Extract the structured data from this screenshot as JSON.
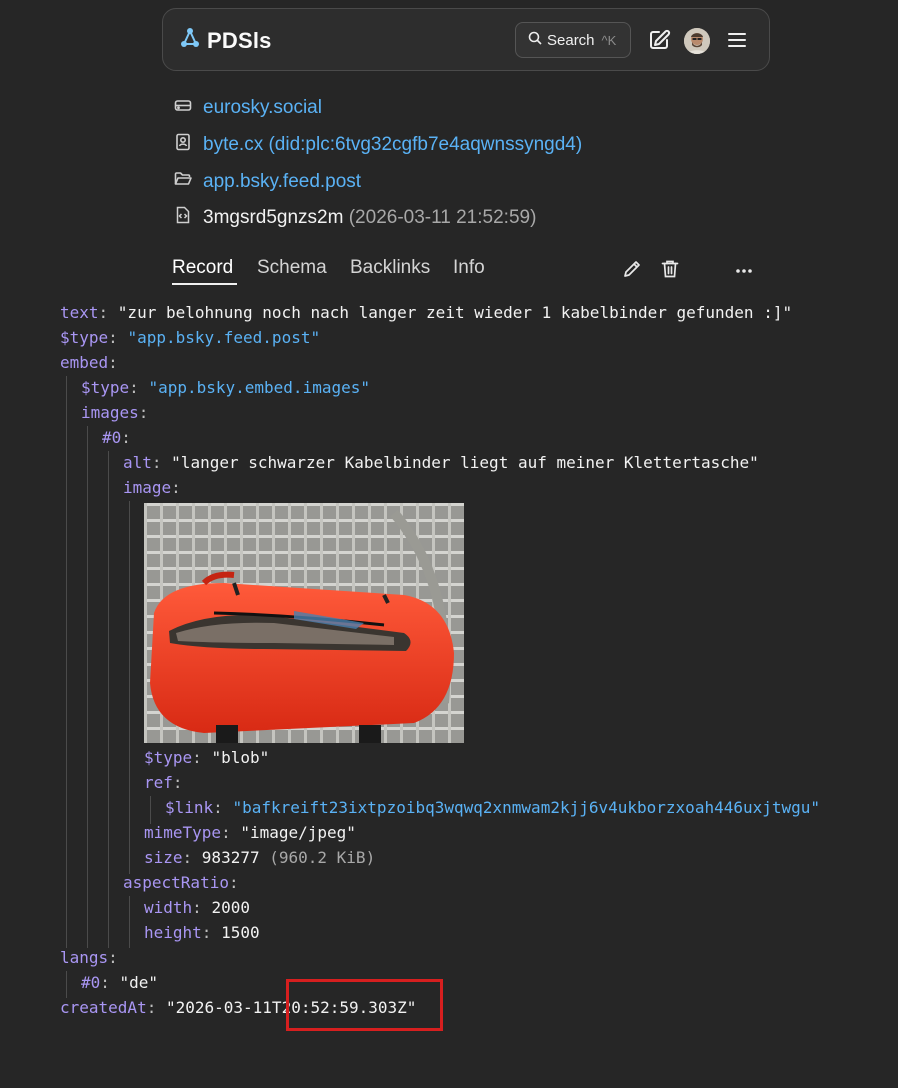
{
  "app": {
    "name": "PDSls"
  },
  "search": {
    "label": "Search",
    "shortcut": "^K"
  },
  "breadcrumbs": [
    {
      "icon": "server-icon",
      "text": "eurosky.social"
    },
    {
      "icon": "contact-card-icon",
      "text": "byte.cx (did:plc:6tvg32cgfb7e4aqwnssyngd4)"
    },
    {
      "icon": "folder-icon",
      "text": "app.bsky.feed.post"
    },
    {
      "icon": "code-file-icon",
      "text": "3mgsrd5gnzs2m",
      "date": "(2026-03-11 21:52:59)"
    }
  ],
  "tabs": [
    "Record",
    "Schema",
    "Backlinks",
    "Info"
  ],
  "active_tab": "Record",
  "record": {
    "text_key": "text",
    "text_value": "\"zur belohnung noch nach langer zeit wieder 1 kabelbinder gefunden :]\"",
    "type_key": "$type",
    "type_value": "\"app.bsky.feed.post\"",
    "embed_key": "embed",
    "embed_type_key": "$type",
    "embed_type_value": "\"app.bsky.embed.images\"",
    "images_key": "images",
    "image0_key": "#0",
    "alt_key": "alt",
    "alt_value": "\"langer schwarzer Kabelbinder liegt auf meiner Klettertasche\"",
    "image_key": "image",
    "blob_type_key": "$type",
    "blob_type_value": "\"blob\"",
    "ref_key": "ref",
    "link_key": "$link",
    "link_value": "\"bafkreift23ixtpzoibq3wqwq2xnmwam2kjj6v4ukborzxoah446uxjtwgu\"",
    "mime_key": "mimeType",
    "mime_value": "\"image/jpeg\"",
    "size_key": "size",
    "size_value": "983277",
    "size_human": "(960.2 KiB)",
    "aspect_key": "aspectRatio",
    "width_key": "width",
    "width_value": "2000",
    "height_key": "height",
    "height_value": "1500",
    "langs_key": "langs",
    "lang0_key": "#0",
    "lang0_value": "\"de\"",
    "created_key": "createdAt",
    "created_value": "\"2026-03-11T20:52:59.303Z\""
  },
  "colors": {
    "background": "#262626",
    "key": "#a996f3",
    "link": "#5ab2f5",
    "highlight": "#d61f1f"
  }
}
